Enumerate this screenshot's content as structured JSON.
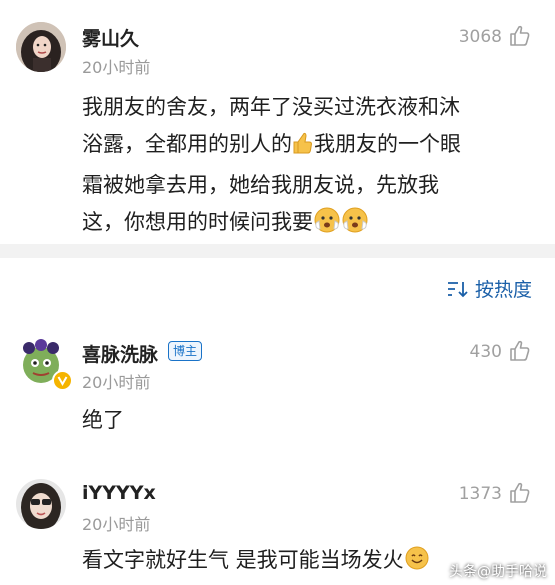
{
  "comments": [
    {
      "username": "雾山久",
      "time": "20小时前",
      "likes": "3068",
      "lines": [
        "我朋友的舍友，两年了没买过洗衣液和沐",
        "浴露，全都用的别人的",
        "我朋友的一个眼",
        "霜被她拿去用，她给我朋友说，先放我",
        "这，你想用的时候问我要"
      ]
    },
    {
      "username": "喜脉洗脉",
      "badge": "博主",
      "time": "20小时前",
      "likes": "430",
      "text": "绝了"
    },
    {
      "username": "iYYYYx",
      "time": "20小时前",
      "likes": "1373",
      "text": "看文字就好生气 是我可能当场发火"
    }
  ],
  "sort": {
    "label": "按热度",
    "icon": "sort-icon"
  },
  "watermark": "头条@助手哈说",
  "colors": {
    "link": "#1a5fa8",
    "badge": "#1a73c8",
    "muted": "#9a9a9a",
    "divider": "#f2f2f2"
  }
}
